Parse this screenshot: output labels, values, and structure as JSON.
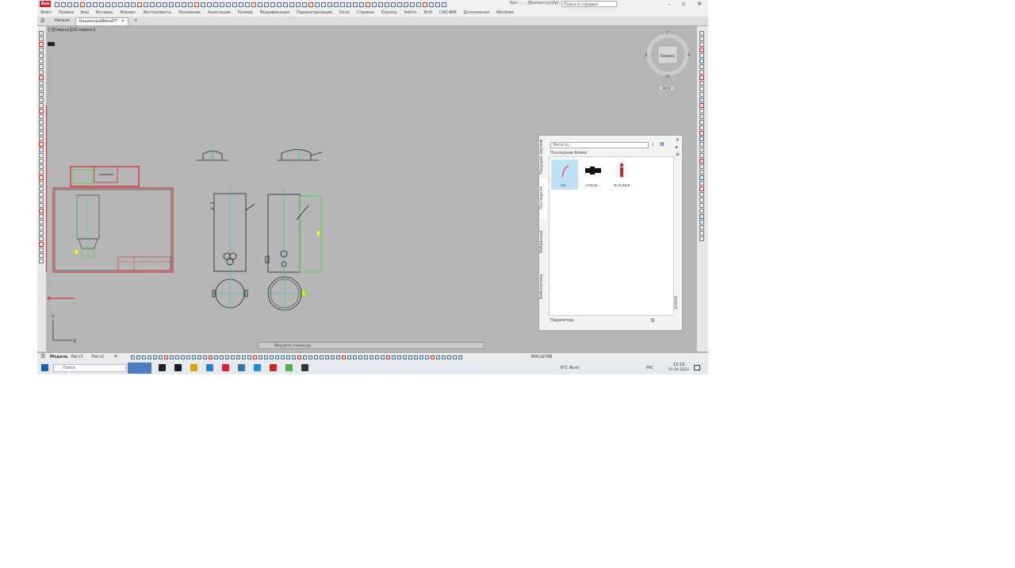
{
  "app": {
    "logo_text": "Ren",
    "title": "Ren: ... - [Bashennyy\\Ppf...]",
    "search_placeholder": "Поиск в справке",
    "window_controls": [
      "–",
      "▫",
      "✕"
    ]
  },
  "menu": [
    "Файл",
    "Правка",
    "Вид",
    "Вставка",
    "Формат",
    "Инструменты",
    "Рисование",
    "Аннотации",
    "Размер",
    "Модификация",
    "Параметризация",
    "Окно",
    "Справка",
    "Express",
    "Add-In",
    "RUS",
    "CAD-BIM",
    "Дополнения",
    "Windows"
  ],
  "tabs": {
    "home_label": "Начало",
    "document_label": "БашенныйФиниП*",
    "close_symbol": "✕",
    "add_symbol": "+"
  },
  "canvas": {
    "view_label": "[-][Сверху][2D-каркас]",
    "command_placeholder": "Введите команду"
  },
  "viewcube": {
    "label": "Сверху",
    "compass_n": "С",
    "compass_s": "Ю",
    "compass_w": "З",
    "compass_e": "В",
    "wcs": "МСК"
  },
  "palette": {
    "vertical_tabs": [
      "Последние",
      "Библиотеки",
      "Избранное",
      "Текущий чертеж"
    ],
    "filter_placeholder": "Фильтр...",
    "section_title": "Последние блоки",
    "tiles": [
      {
        "label": "A$..."
      },
      {
        "label": "Отвод..."
      },
      {
        "label": "ЧЕЛОВЕК"
      }
    ],
    "bottom_label": "Параметры",
    "side_label": "БЛОКИ"
  },
  "statusbar": {
    "tabs": [
      "Модель",
      "Лист1",
      "Лист2"
    ],
    "add_symbol": "+",
    "scale": "МАСШТАБ"
  },
  "taskbar": {
    "search_placeholder": "Поиск",
    "weather": "6°C Ясно",
    "lang": "РУС",
    "time": "15:16",
    "date": "01.04.2023"
  },
  "colors": {
    "accent": "#d0242b",
    "selection": "#bfe0f5",
    "canvas": "#b6b6b6",
    "cad_cyan": "#1fc8c8",
    "cad_green": "#3fd33f"
  }
}
